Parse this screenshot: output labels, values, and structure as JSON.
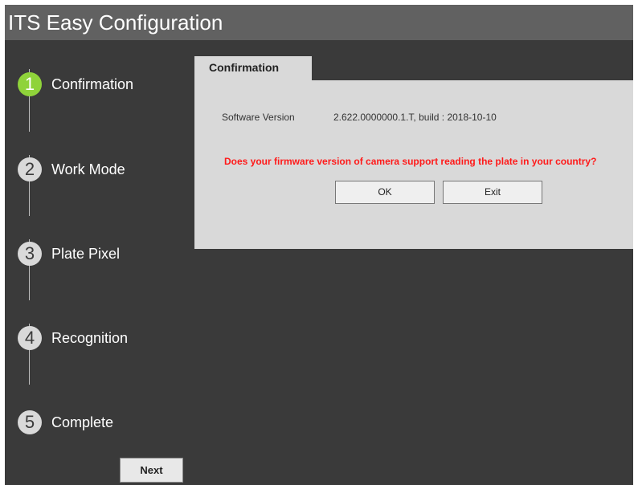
{
  "window": {
    "title": "ITS Easy Configuration"
  },
  "steps": [
    {
      "number": "1",
      "label": "Confirmation",
      "active": true
    },
    {
      "number": "2",
      "label": "Work Mode",
      "active": false
    },
    {
      "number": "3",
      "label": "Plate Pixel",
      "active": false
    },
    {
      "number": "4",
      "label": "Recognition",
      "active": false
    },
    {
      "number": "5",
      "label": "Complete",
      "active": false
    }
  ],
  "footer": {
    "next_label": "Next"
  },
  "panel": {
    "tab_label": "Confirmation",
    "software_version_label": "Software Version",
    "software_version_value": "2.622.0000000.1.T, build : 2018-10-10",
    "question": "Does your firmware version of camera support reading the plate in your country?",
    "ok_label": "OK",
    "exit_label": "Exit"
  },
  "colors": {
    "active_step": "#8fd33a",
    "question_text": "#ff1a1a",
    "title_bar": "#616161",
    "background": "#3a3a3a",
    "panel": "#d9d9d9"
  }
}
